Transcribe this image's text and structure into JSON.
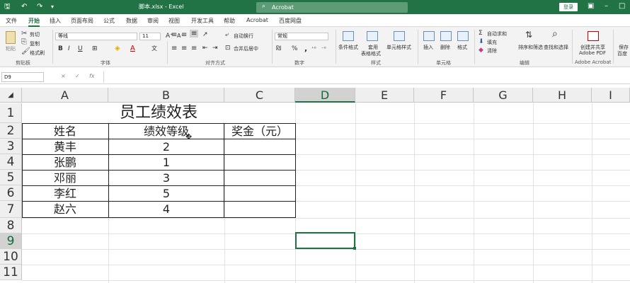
{
  "window": {
    "title": "脚本.xlsx - Excel",
    "search_icon": "⌕",
    "search_text": "Acrobat",
    "login": "登录"
  },
  "tabs": [
    "文件",
    "开始",
    "插入",
    "页面布局",
    "公式",
    "数据",
    "审阅",
    "视图",
    "开发工具",
    "帮助",
    "Acrobat",
    "百度网盘"
  ],
  "active_tab": "开始",
  "ribbon": {
    "clipboard": {
      "paste": "粘贴",
      "cut": "剪切",
      "copy": "复制",
      "format_painter": "格式刷",
      "group": "剪贴板"
    },
    "font": {
      "name": "等线",
      "size": "11",
      "group": "字体",
      "bold": "B",
      "italic": "I",
      "underline": "U",
      "font_color": "A"
    },
    "alignment": {
      "wrap": "自动换行",
      "merge": "合并后居中",
      "group": "对齐方式"
    },
    "number": {
      "format": "常规",
      "group": "数字",
      "percent": "%",
      "comma": ","
    },
    "styles": {
      "cond": "条件格式",
      "table1": "套用",
      "table2": "表格格式",
      "cell_styles": "单元格样式",
      "group": "样式"
    },
    "cells": {
      "insert": "插入",
      "delete": "删除",
      "format": "格式",
      "group": "单元格"
    },
    "editing": {
      "autosum": "自动求和",
      "fill": "填充",
      "clear": "清除",
      "sort": "排序和筛选",
      "find": "查找和选择",
      "group": "编辑"
    },
    "acrobat": {
      "create1": "创建并共享",
      "create2": "Adobe PDF",
      "save1": "保存",
      "save2": "百度",
      "group": "Adobe Acrobat"
    }
  },
  "formula_bar": {
    "name_box": "D9",
    "cancel": "×",
    "enter": "✓",
    "fx": "fx"
  },
  "columns": [
    "A",
    "B",
    "C",
    "D",
    "E",
    "F",
    "G",
    "H",
    "I"
  ],
  "rows": [
    "1",
    "2",
    "3",
    "4",
    "5",
    "6",
    "7",
    "8",
    "9",
    "10",
    "11"
  ],
  "selected_col": "D",
  "selected_row": "9",
  "sheet": {
    "title": "员工绩效表",
    "headers": [
      "姓名",
      "绩效等级",
      "奖金（元）"
    ],
    "data": [
      [
        "黄丰",
        "2",
        ""
      ],
      [
        "张鹏",
        "1",
        ""
      ],
      [
        "邓丽",
        "3",
        ""
      ],
      [
        "李红",
        "5",
        ""
      ],
      [
        "赵六",
        "4",
        ""
      ]
    ]
  }
}
